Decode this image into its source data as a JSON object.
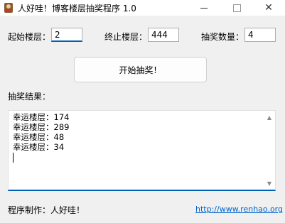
{
  "window": {
    "title": "人好哇！博客楼层抽奖程序 1.0",
    "icon": "app-icon",
    "controls": {
      "minimize": "—",
      "maximize": "☐",
      "close": "✕"
    }
  },
  "form": {
    "start_floor": {
      "label": "起始楼层：",
      "value": "2"
    },
    "end_floor": {
      "label": "终止楼层：",
      "value": "444"
    },
    "draw_count": {
      "label": "抽奖数量：",
      "value": "4"
    }
  },
  "start_button": {
    "label": "开始抽奖！"
  },
  "results": {
    "label": "抽奖结果：",
    "lines": [
      "幸运楼层：174",
      "幸运楼层：289",
      "幸运楼层：48",
      "幸运楼层：34"
    ]
  },
  "footer": {
    "credit": "程序制作：人好哇！",
    "link": "http://www.renhao.org"
  },
  "colors": {
    "accent": "#005fb8",
    "link": "#0066cc"
  }
}
